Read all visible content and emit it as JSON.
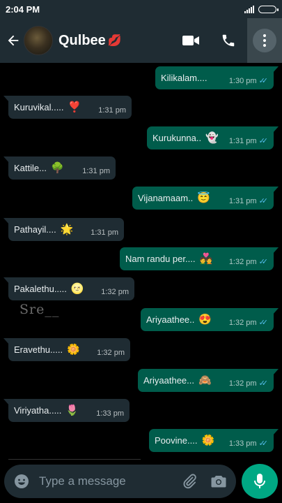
{
  "status_bar": {
    "time": "2:04 PM"
  },
  "header": {
    "contact_name": "Qulbee",
    "name_emoji": "💋",
    "icons": [
      "back-arrow-icon",
      "video-call-icon",
      "voice-call-icon",
      "more-options-icon"
    ]
  },
  "messages": [
    {
      "dir": "out",
      "text": "Kilikalam....",
      "emoji": "",
      "time": "1:30 pm",
      "read": true
    },
    {
      "dir": "in",
      "text": "Kuruvikal.....",
      "emoji": "❣️",
      "time": "1:31 pm"
    },
    {
      "dir": "out",
      "text": "Kurukunna..",
      "emoji": "👻",
      "time": "1:31 pm",
      "read": true
    },
    {
      "dir": "in",
      "text": "Kattile...",
      "emoji": "🌳",
      "time": "1:31 pm"
    },
    {
      "dir": "out",
      "text": "Vijanamaam..",
      "emoji": "😇",
      "time": "1:31 pm",
      "read": true
    },
    {
      "dir": "in",
      "text": "Pathayil....",
      "emoji": "🌟",
      "time": "1:31 pm"
    },
    {
      "dir": "out",
      "text": "Nam randu per....",
      "emoji": "💑",
      "time": "1:32 pm",
      "read": true
    },
    {
      "dir": "in",
      "text": "Pakalethu.....",
      "emoji": "🌝",
      "time": "1:32 pm"
    },
    {
      "dir": "out",
      "text": "Ariyaathee..",
      "emoji": "😍",
      "time": "1:32 pm",
      "read": true
    },
    {
      "dir": "in",
      "text": "Eravethu.....",
      "emoji": "🌼",
      "time": "1:32 pm"
    },
    {
      "dir": "out",
      "text": "Ariyaathee...",
      "emoji": "🙈",
      "time": "1:32 pm",
      "read": true
    },
    {
      "dir": "in",
      "text": "Viriyatha.....",
      "emoji": "🌷",
      "time": "1:33 pm"
    },
    {
      "dir": "out",
      "text": "Poovine....",
      "emoji": "🌼",
      "time": "1:33 pm",
      "read": true
    }
  ],
  "overlay_text": "Sre__",
  "composer": {
    "placeholder": "Type a message"
  },
  "colors": {
    "incoming": "#1f2c33",
    "outgoing": "#005c4b",
    "accent": "#00a884",
    "read_ticks": "#53bdeb"
  }
}
